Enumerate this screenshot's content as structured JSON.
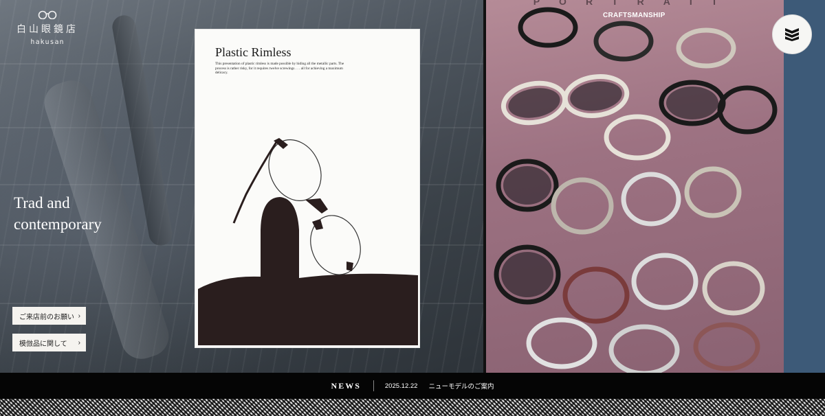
{
  "brand": {
    "name_jp": "白山眼鏡店",
    "name_en": "hakusan"
  },
  "hero": {
    "tagline_line1": "Trad and",
    "tagline_line2": "contemporary",
    "poster": {
      "title": "Plastic Rimless",
      "text": "This presentation of plastic rimless is made possible by hiding all the metallic parts. The process is rather risky, for it requires twelve screwings . . . all for achieving a maximum delicacy."
    },
    "right_photo": {
      "label": "CRAFTSMANSHIP",
      "top_text": "PORTRAIT"
    }
  },
  "side_buttons": [
    {
      "label": "ご来店前のお願い",
      "icon": "chevron-right-icon"
    },
    {
      "label": "模倣品に関して",
      "icon": "chevron-right-icon"
    }
  ],
  "menu": {
    "icon": "menu-icon"
  },
  "news": {
    "label": "NEWS",
    "date": "2025.12.22",
    "title": "ニューモデルのご案内"
  },
  "colors": {
    "news_bg": "#050505",
    "accent_blue": "#3d5a78",
    "button_bg": "#f5f3ef"
  }
}
